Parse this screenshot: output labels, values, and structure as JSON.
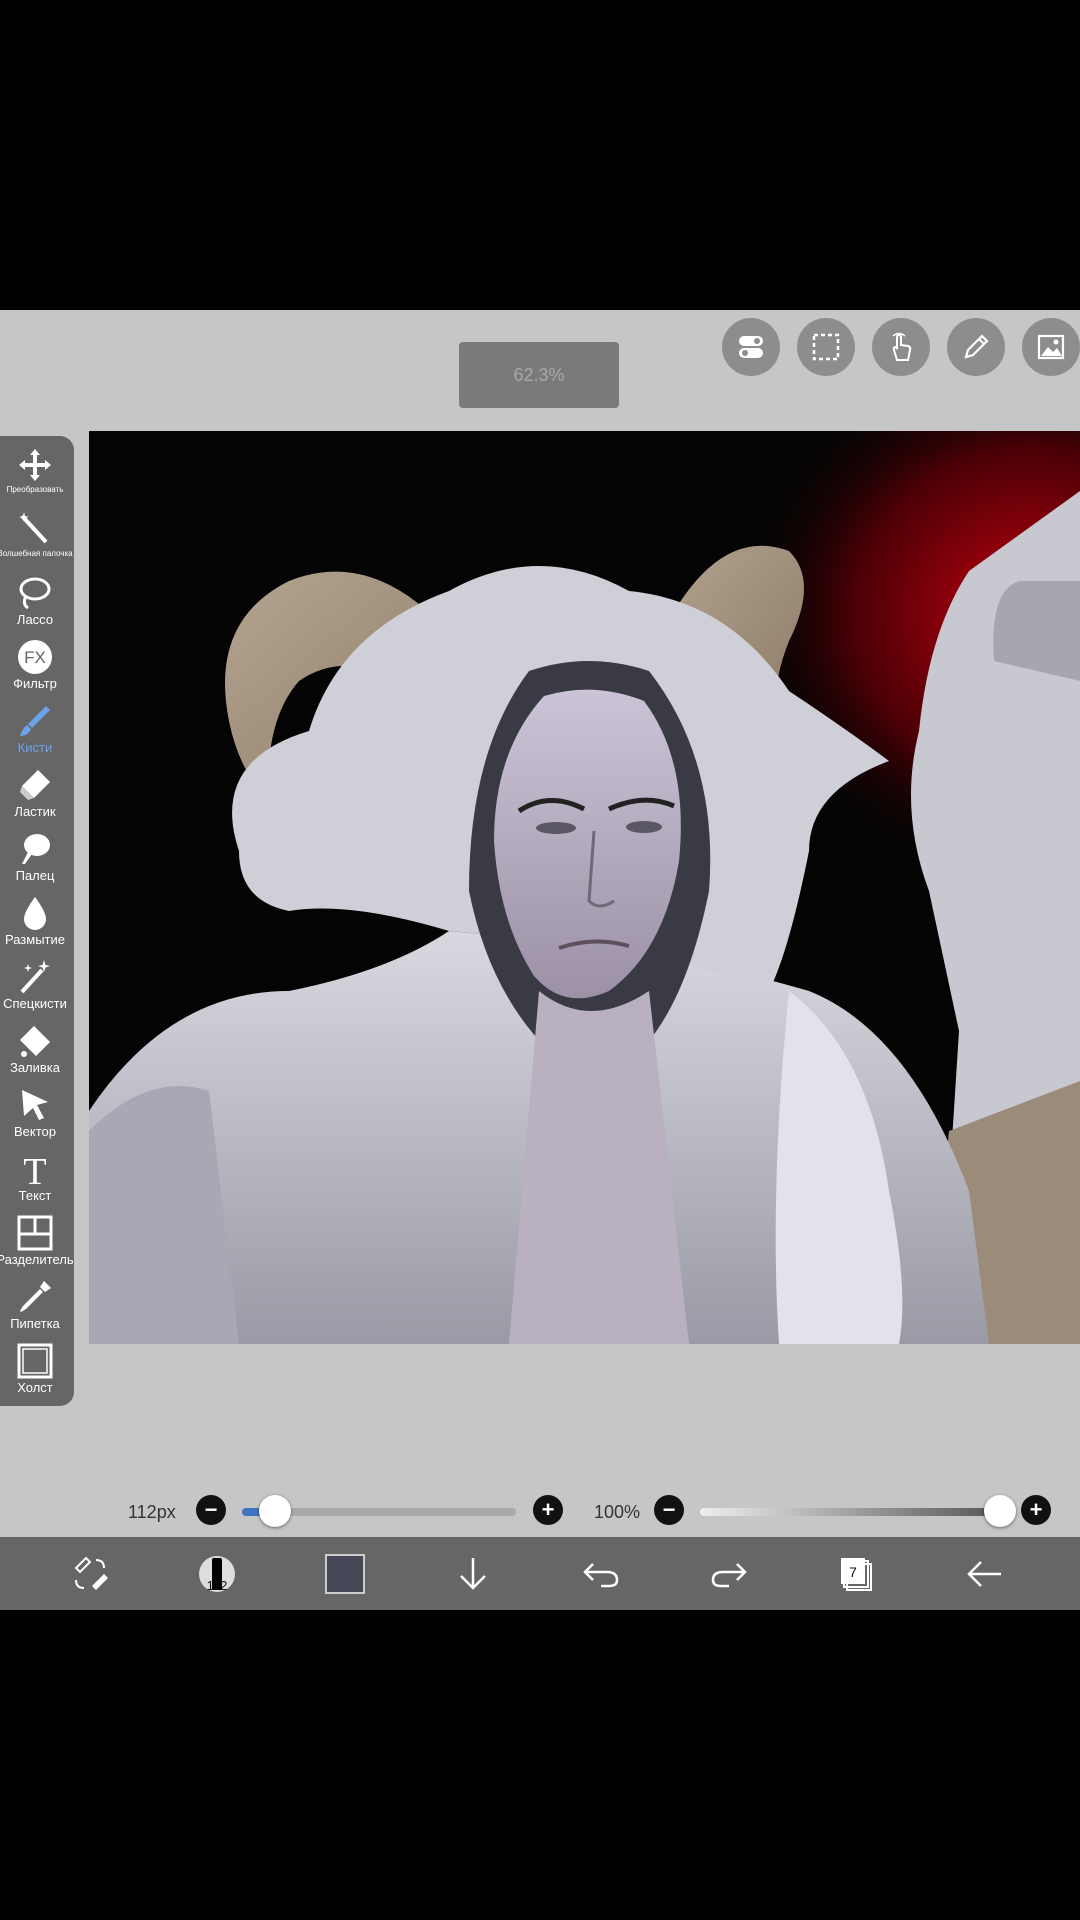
{
  "zoom": {
    "label": "62.3%"
  },
  "top_tools": [
    {
      "icon": "toggle-icon"
    },
    {
      "icon": "selection-icon"
    },
    {
      "icon": "hand-icon"
    },
    {
      "icon": "pencil-icon"
    },
    {
      "icon": "image-icon"
    }
  ],
  "toolbar": {
    "transform": "Преобразовать",
    "magic_wand": "Волшебная палочка",
    "lasso": "Лассо",
    "filter": "Фильтр",
    "brush": "Кисти",
    "eraser": "Ластик",
    "finger": "Палец",
    "blur": "Размытие",
    "special_brush": "Спецкисти",
    "fill": "Заливка",
    "vector": "Вектор",
    "text": "Текст",
    "divider": "Разделитель",
    "eyedropper": "Пипетка",
    "canvas": "Холст"
  },
  "filter_badge": "FX",
  "text_tool_glyph": "T",
  "brush_size": {
    "label": "112px",
    "level": 0.12
  },
  "opacity": {
    "label": "100%",
    "level": 1.0
  },
  "bottom": {
    "brush_preview_value": "112",
    "layers_count": "7",
    "current_color": "#454656"
  },
  "colors": {
    "accent": "#6aa3ea",
    "toolbar_bg": "#666666",
    "canvas_bg": "#040404",
    "backdrop": "#c6c6c6"
  }
}
